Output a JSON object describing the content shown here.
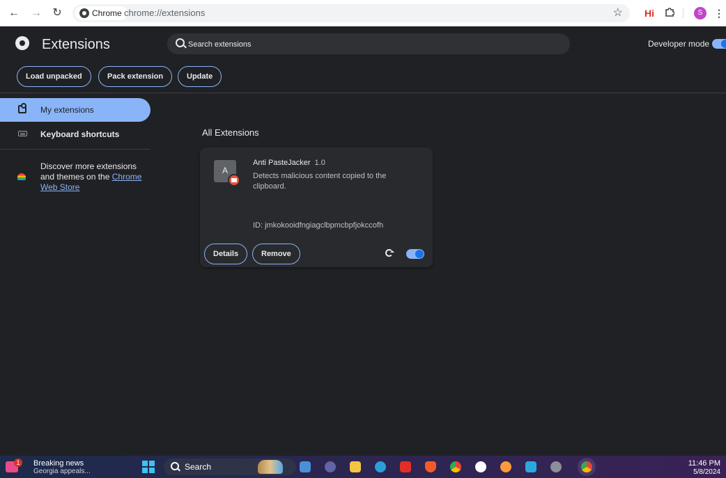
{
  "browser": {
    "chip_label": "Chrome",
    "url": "chrome://extensions",
    "hi_label": "Hi",
    "profile_initial": "S"
  },
  "header": {
    "title": "Extensions",
    "search_placeholder": "Search extensions",
    "developer_mode_label": "Developer mode",
    "developer_mode_on": true,
    "buttons": {
      "load_unpacked": "Load unpacked",
      "pack_extension": "Pack extension",
      "update": "Update"
    }
  },
  "sidebar": {
    "items": [
      {
        "label": "My extensions",
        "icon": "puzzle-icon",
        "active": true
      },
      {
        "label": "Keyboard shortcuts",
        "icon": "keyboard-icon",
        "active": false
      }
    ],
    "discover": {
      "text": "Discover more extensions and themes on the ",
      "link": "Chrome Web Store"
    }
  },
  "main": {
    "section_title": "All Extensions",
    "extensions": [
      {
        "icon_letter": "A",
        "name": "Anti PasteJacker",
        "version": "1.0",
        "description": "Detects malicious content copied to the clipboard.",
        "id_text": "ID: jmkokooidfngiagclbpmcbpfjokccofh",
        "details_label": "Details",
        "remove_label": "Remove",
        "enabled": true
      }
    ]
  },
  "taskbar": {
    "news_badge": "1",
    "news_title": "Breaking news",
    "news_subtitle": "Georgia appeals...",
    "search_label": "Search",
    "time": "11:46 PM",
    "date": "5/8/2024",
    "apps": [
      "file-explorer-icon",
      "teams-icon",
      "folder-icon",
      "edge-icon",
      "youtube-icon",
      "brave-icon",
      "chrome-icon",
      "maps-icon",
      "firefox-icon",
      "app-icon",
      "settings-icon",
      "chrome-active-icon"
    ]
  },
  "colors": {
    "accent": "#8ab4f8",
    "background": "#202124",
    "card": "#292a2d"
  }
}
